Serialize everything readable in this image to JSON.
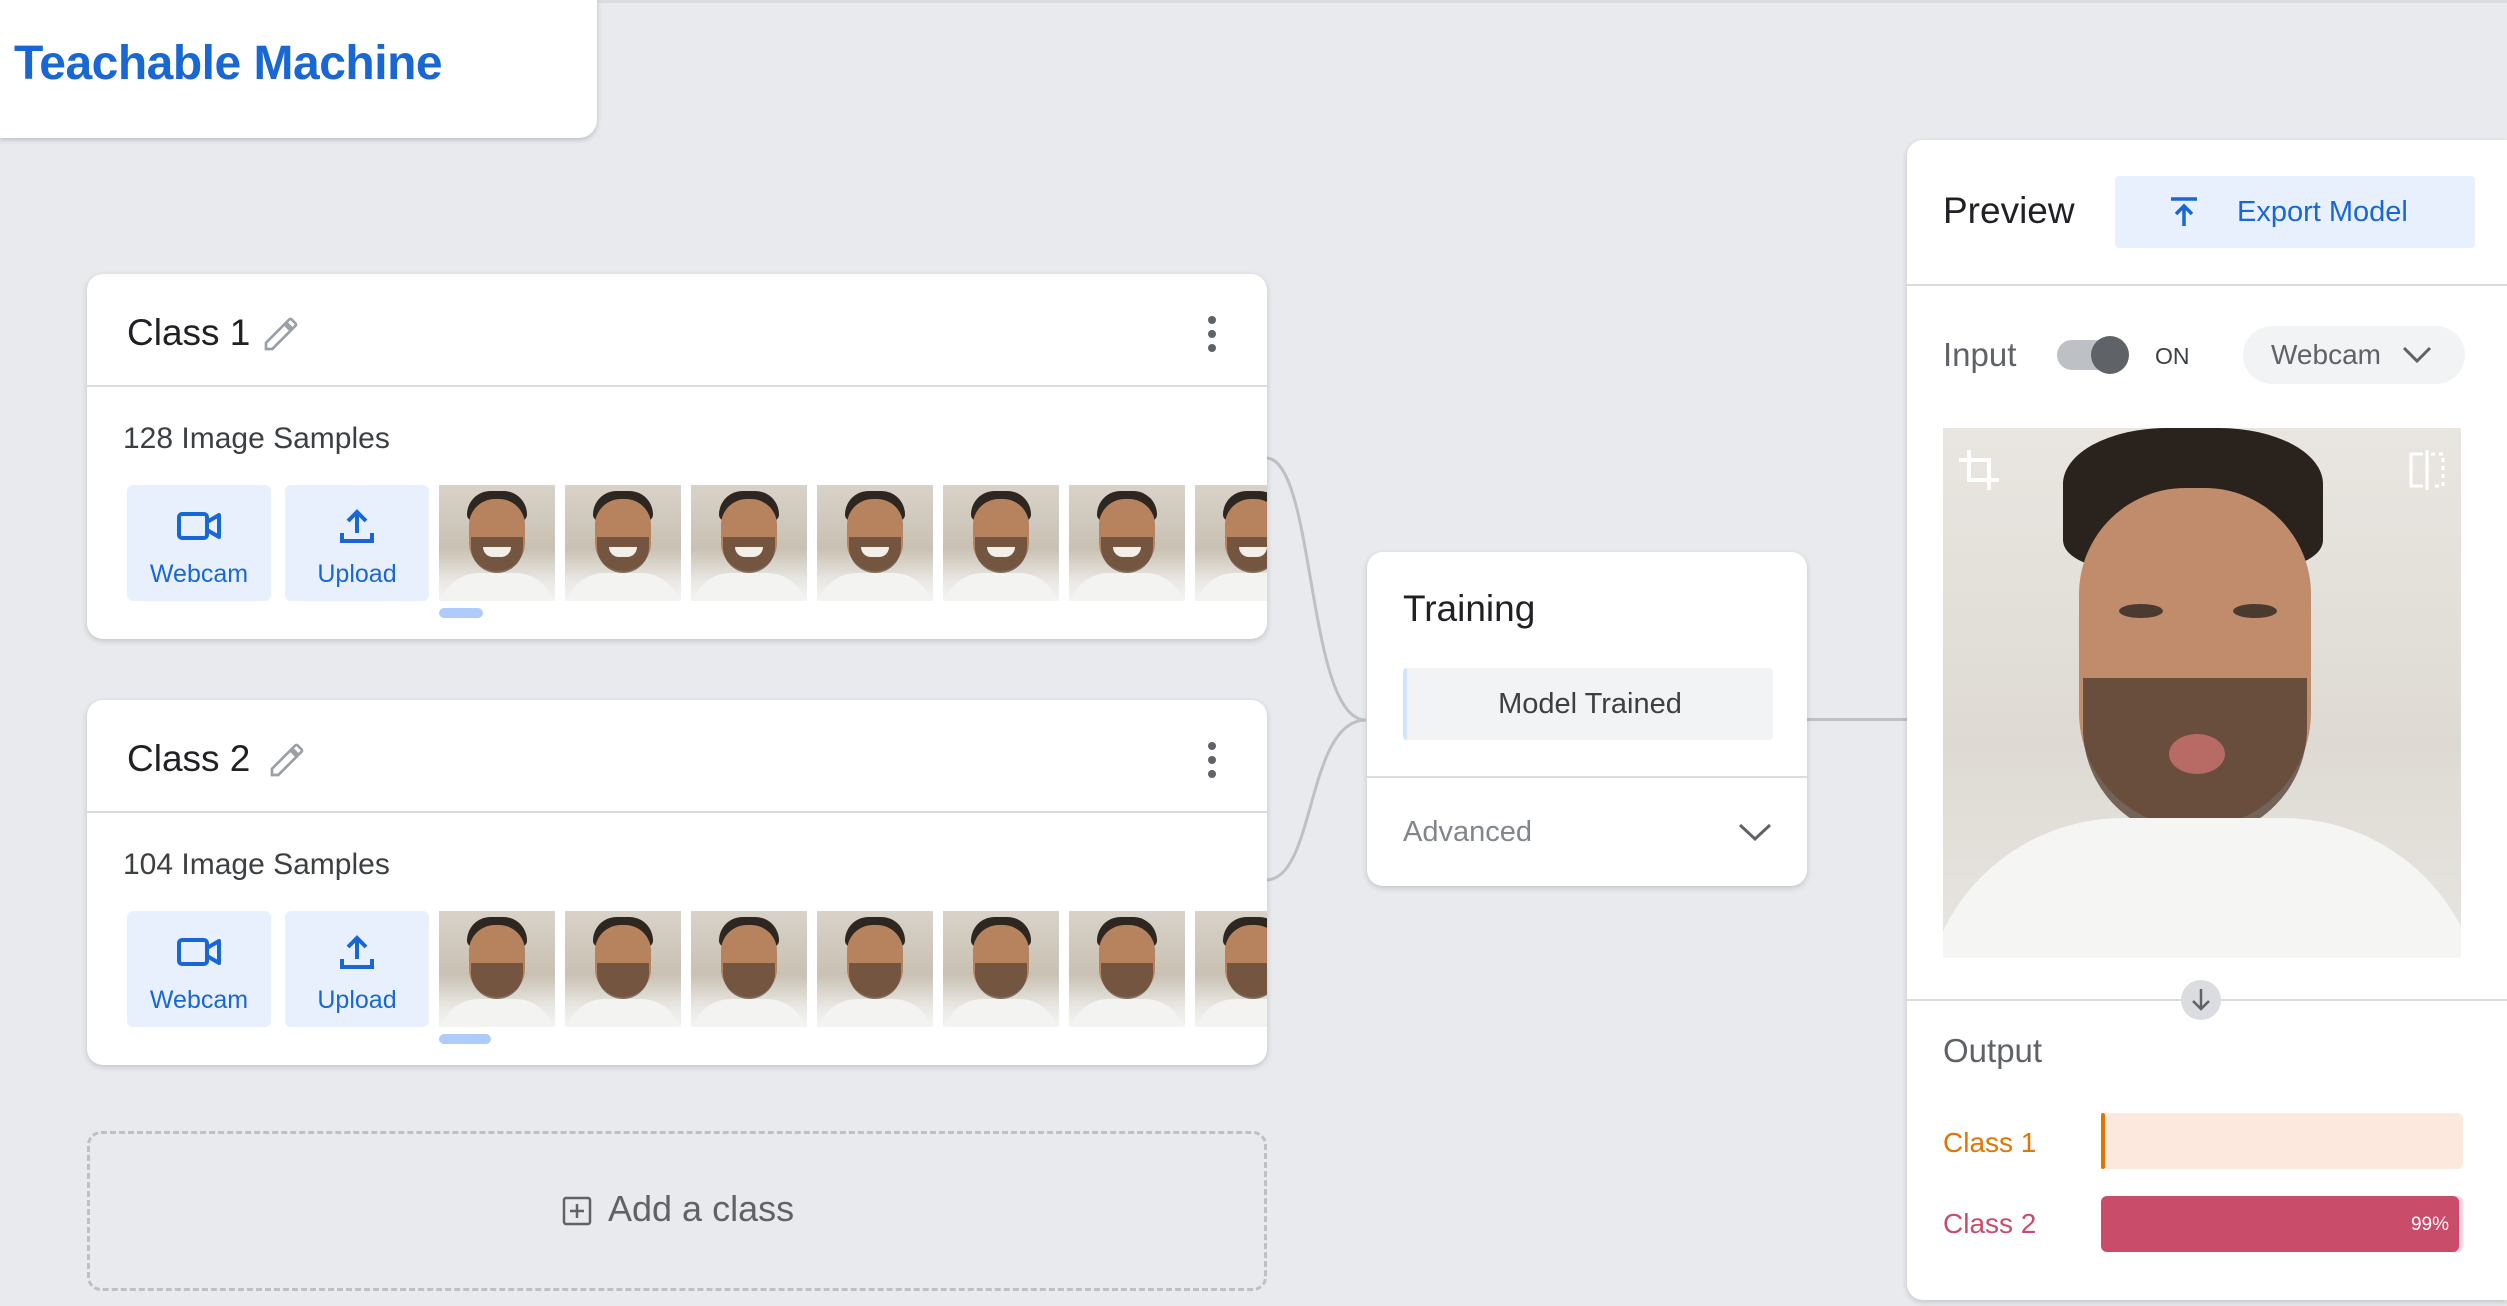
{
  "app": {
    "title": "Teachable Machine"
  },
  "classes": [
    {
      "name": "Class 1",
      "samples_label": "128 Image Samples",
      "webcam_label": "Webcam",
      "upload_label": "Upload"
    },
    {
      "name": "Class 2",
      "samples_label": "104 Image Samples",
      "webcam_label": "Webcam",
      "upload_label": "Upload"
    }
  ],
  "add_class": {
    "label": "Add a class"
  },
  "training": {
    "title": "Training",
    "status_button": "Model Trained",
    "advanced_label": "Advanced"
  },
  "preview": {
    "title": "Preview",
    "export_label": "Export Model",
    "input_label": "Input",
    "toggle_state": "ON",
    "input_source": "Webcam",
    "output_label": "Output",
    "outputs": [
      {
        "label": "Class 1",
        "confidence": 0.01,
        "percent_text": "",
        "color": "#e37400",
        "bg": "#fce8dd"
      },
      {
        "label": "Class 2",
        "confidence": 0.99,
        "percent_text": "99%",
        "color": "#c94d6a",
        "bg": "#f6d6de"
      }
    ]
  },
  "colors": {
    "accent": "#1967d2",
    "accent_bg": "#e8f0fe",
    "page_bg": "#e8eaed"
  },
  "icons": [
    "pencil-icon",
    "more-vert-icon",
    "videocam-icon",
    "upload-icon",
    "add-box-icon",
    "export-icon",
    "chevron-down-icon",
    "crop-icon",
    "flip-icon",
    "arrow-down-icon"
  ]
}
